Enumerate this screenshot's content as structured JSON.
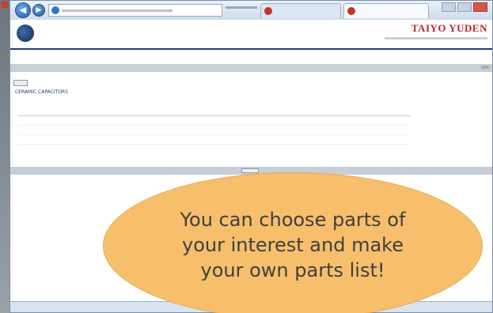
{
  "browser": {
    "tabs": [
      {
        "label": ""
      },
      {
        "label": ""
      }
    ]
  },
  "site": {
    "name": "",
    "subtitle": "",
    "brand": "TAIYO YUDEN"
  },
  "results": {
    "title": "CERAMIC CAPACITORS"
  },
  "table": {
    "columns": [
      "",
      "",
      "",
      "",
      "",
      "",
      "",
      "",
      "",
      "",
      "",
      "",
      "",
      ""
    ],
    "rows": [
      [
        "",
        "",
        "",
        "",
        "",
        "",
        "",
        "",
        "",
        "",
        "",
        "",
        "",
        ""
      ],
      [
        "",
        "",
        "",
        "",
        "",
        "",
        "",
        "",
        "",
        "",
        "",
        "",
        "",
        ""
      ],
      [
        "",
        "",
        "",
        "",
        "",
        "",
        "",
        "",
        "",
        "",
        "",
        "",
        "",
        ""
      ]
    ]
  },
  "callout": {
    "lines": [
      "You can choose parts of",
      "your interest and make",
      "your own parts list!"
    ]
  },
  "colors": {
    "accent": "#1f3f75",
    "brand": "#b8282d",
    "callout": "#f7bf6c"
  }
}
